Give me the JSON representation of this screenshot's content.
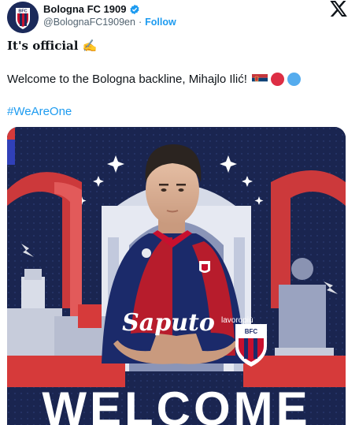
{
  "account": {
    "display_name": "Bologna FC 1909",
    "handle": "@BolognaFC1909en",
    "separator": "·",
    "follow_label": "Follow",
    "avatar_text": "BFC",
    "avatar_year": "1909"
  },
  "tweet": {
    "line1": "It's official ✍️",
    "line2": "Welcome to the Bologna backline, Mihajlo Ilić!",
    "hashtag": "#WeAreOne"
  },
  "media": {
    "headline": "WELCOME",
    "sponsor": "Saputo",
    "sleeve_sponsor": "lavoropiù",
    "crest_text": "BFC",
    "crest_year": "1909"
  },
  "colors": {
    "navy": "#1a2550",
    "red": "#d63a3a",
    "blue_link": "#1d9bf0",
    "emoji_red": "#dd2e44",
    "emoji_blue": "#55acee"
  }
}
